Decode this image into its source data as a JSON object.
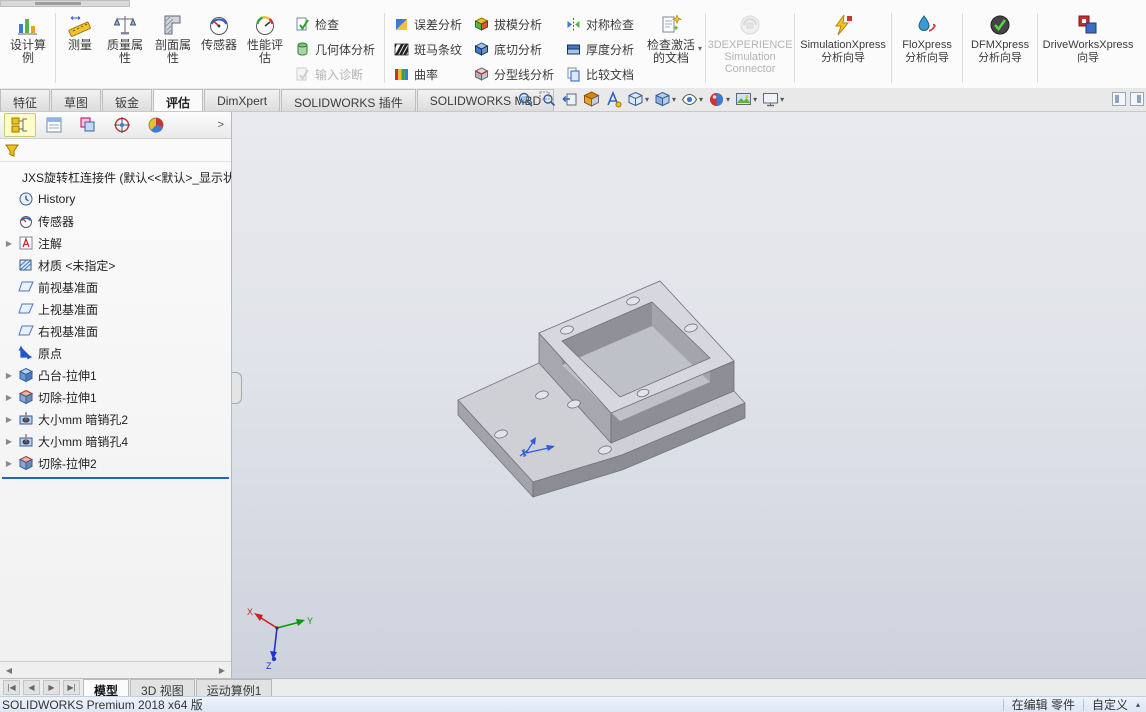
{
  "glyphs": {
    "caret_down": "▾",
    "caret_up": "▴",
    "expand": "▶",
    "scroll_left": "◀",
    "scroll_right": "▶",
    "nav_first": "|◀",
    "nav_prev": "◀",
    "nav_next": "▶",
    "nav_last": "▶|",
    "panel_expand": ">"
  },
  "ribbon": {
    "design_study": "设计算例",
    "measure": "测量",
    "mass_properties": "质量属性",
    "section_properties": "剖面属性",
    "sensor": "传感器",
    "performance_evaluation": "性能评估",
    "check": "检查",
    "geometry_analysis": "几何体分析",
    "import_diagnostics": "输入诊断",
    "deviation_analysis": "误差分析",
    "zebra_stripes": "斑马条纹",
    "curvature": "曲率",
    "draft_analysis": "拔模分析",
    "undercut_analysis": "底切分析",
    "parting_line_analysis": "分型线分析",
    "symmetry_check": "对称检查",
    "thickness_analysis": "厚度分析",
    "compare_documents": "比较文档",
    "check_active_document": "检查激活的文档",
    "experience_connector": "3DEXPERIENCE Simulation Connector",
    "simulationxpress": "SimulationXpress 分析向导",
    "floxpress": "FloXpress 分析向导",
    "dfmxpress": "DFMXpress 分析向导",
    "driveworksxpress": "DriveWorksXpress 向导"
  },
  "command_tabs": [
    "特征",
    "草图",
    "钣金",
    "评估",
    "DimXpert",
    "SOLIDWORKS 插件",
    "SOLIDWORKS MBD"
  ],
  "feature_tree": {
    "root_label": "JXS旋转杠连接件 (默认<<默认>_显示状",
    "items": [
      {
        "label": "History"
      },
      {
        "label": "传感器"
      },
      {
        "label": "注解"
      },
      {
        "label": "材质 <未指定>"
      },
      {
        "label": "前视基准面"
      },
      {
        "label": "上视基准面"
      },
      {
        "label": "右视基准面"
      },
      {
        "label": "原点"
      },
      {
        "label": "凸台-拉伸1"
      },
      {
        "label": "切除-拉伸1"
      },
      {
        "label": "大小mm 暗销孔2"
      },
      {
        "label": "大小mm 暗销孔4"
      },
      {
        "label": "切除-拉伸2"
      }
    ]
  },
  "viewport": {
    "triad": {
      "x": "X",
      "y": "Y",
      "z": "Z"
    }
  },
  "bottom_tabs": [
    "模型",
    "3D 视图",
    "运动算例1"
  ],
  "status_bar": {
    "app_version": "SOLIDWORKS Premium 2018 x64 版",
    "editing_state": "在编辑 零件",
    "custom": "自定义"
  }
}
